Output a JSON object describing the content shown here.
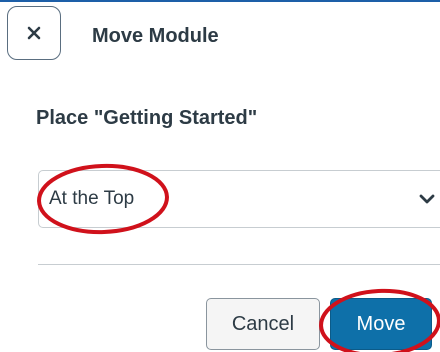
{
  "dialog": {
    "title": "Move Module",
    "close_icon": "close-icon",
    "place_label": "Place \"Getting Started\""
  },
  "position_select": {
    "selected": "At the Top",
    "icon": "chevron-down-icon"
  },
  "footer": {
    "cancel_label": "Cancel",
    "move_label": "Move"
  },
  "colors": {
    "primary_button": "#0e70a9",
    "text": "#2d3b45",
    "annotation": "#d0111b",
    "border": "#c7cdd1"
  }
}
